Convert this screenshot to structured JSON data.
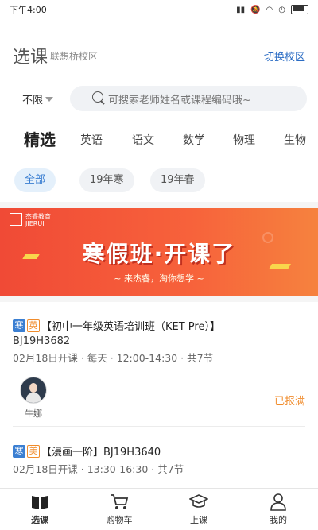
{
  "status_bar": {
    "time": "下午4:00"
  },
  "header": {
    "title": "选课",
    "campus": "联想桥校区",
    "switch_label": "切换校区"
  },
  "filter": {
    "label": "不限"
  },
  "search": {
    "placeholder": "可搜索老师姓名或课程编码哦~"
  },
  "subject_tabs": [
    "精选",
    "英语",
    "语文",
    "数学",
    "物理",
    "生物"
  ],
  "season_chips": [
    "全部",
    "19年寒",
    "19年春"
  ],
  "banner": {
    "logo_text": "杰睿教育\nJIERUI",
    "headline": "寒假班·开课了",
    "subtitle": "~ 来杰睿，淘你想学 ~"
  },
  "courses": [
    {
      "season_tag": "寒",
      "subject_tag": "英",
      "title": "【初中一年级英语培训班（KET Pre）】",
      "code": "BJ19H3682",
      "meta": "02月18日开课 · 每天 · 12:00-14:30 · 共7节",
      "teacher": "牛娜",
      "status": "已报满"
    },
    {
      "season_tag": "寒",
      "subject_tag": "美",
      "title": "【漫画一阶】BJ19H3640",
      "meta": "02月18日开课 · 13:30-16:30 · 共7节"
    }
  ],
  "tabbar": {
    "items": [
      "选课",
      "购物车",
      "上课",
      "我的"
    ]
  },
  "colors": {
    "accent": "#3b7fd2",
    "orange": "#f08c2c",
    "banner": "#f04a36"
  }
}
